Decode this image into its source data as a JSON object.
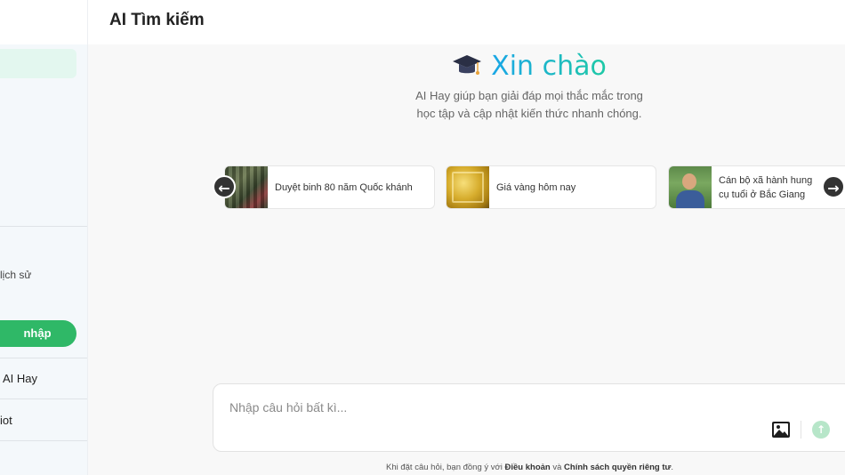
{
  "header": {
    "title": "AI Tìm kiếm"
  },
  "sidebar": {
    "history_label": "lịch sử",
    "login_label": "nhập",
    "links": [
      {
        "label": "AI Hay"
      },
      {
        "label": "iot"
      }
    ]
  },
  "hero": {
    "icon": "graduation-cap-icon",
    "greeting": "Xin chào",
    "subtitle_line1": "AI Hay giúp bạn giải đáp mọi thắc mắc trong",
    "subtitle_line2": "học tập và cập nhật kiến thức nhanh chóng."
  },
  "suggestions": [
    {
      "text": "Duyệt binh 80 năm Quốc khánh",
      "image": "soldiers-parade-photo"
    },
    {
      "text": "Giá vàng hôm nay",
      "image": "gold-bars-photo"
    },
    {
      "text": "Cán bộ xã hành hung cụ tuổi ở Bắc Giang",
      "image": "man-portrait-photo"
    }
  ],
  "arrows": {
    "prev": "arrow-left-icon",
    "next": "arrow-right-icon"
  },
  "input": {
    "placeholder": "Nhập câu hỏi bất kì...",
    "value": ""
  },
  "footer": {
    "prefix": "Khi đặt câu hỏi, bạn đồng ý với ",
    "terms": "Điều khoản",
    "and": " và ",
    "privacy": "Chính sách quyền riêng tư",
    "suffix": "."
  },
  "colors": {
    "accent_green": "#2fb867",
    "greeting_gradient_start": "#1aa6e6",
    "greeting_gradient_end": "#1fc9a6",
    "send_button": "#b7e6c9"
  }
}
